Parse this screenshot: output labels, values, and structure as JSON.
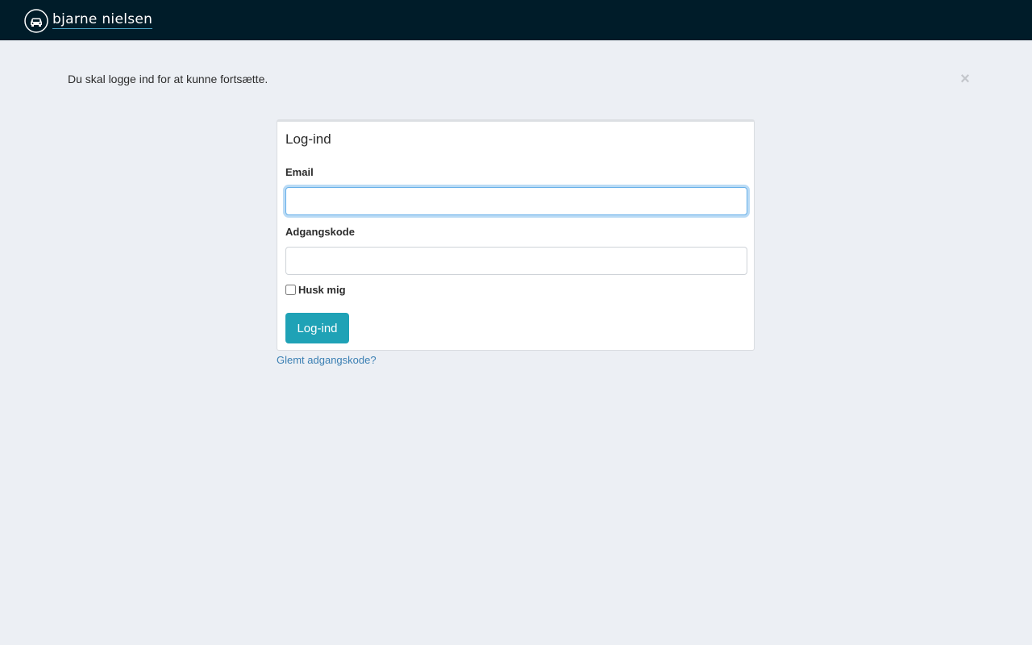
{
  "header": {
    "brand_name": "bjarne nielsen",
    "logo_icon": "car-in-circle-icon",
    "background_color": "#001c29"
  },
  "flash": {
    "message": "Du skal logge ind for at kunne fortsætte.",
    "close_symbol": "×"
  },
  "login_panel": {
    "title": "Log-ind",
    "email_label": "Email",
    "email_value": "",
    "password_label": "Adgangskode",
    "password_value": "",
    "remember_label": "Husk mig",
    "remember_checked": false,
    "submit_label": "Log-ind",
    "submit_color": "#1fa2b6"
  },
  "forgot_password": {
    "label": "Glemt adgangskode?",
    "link_color": "#3a7fb3"
  }
}
